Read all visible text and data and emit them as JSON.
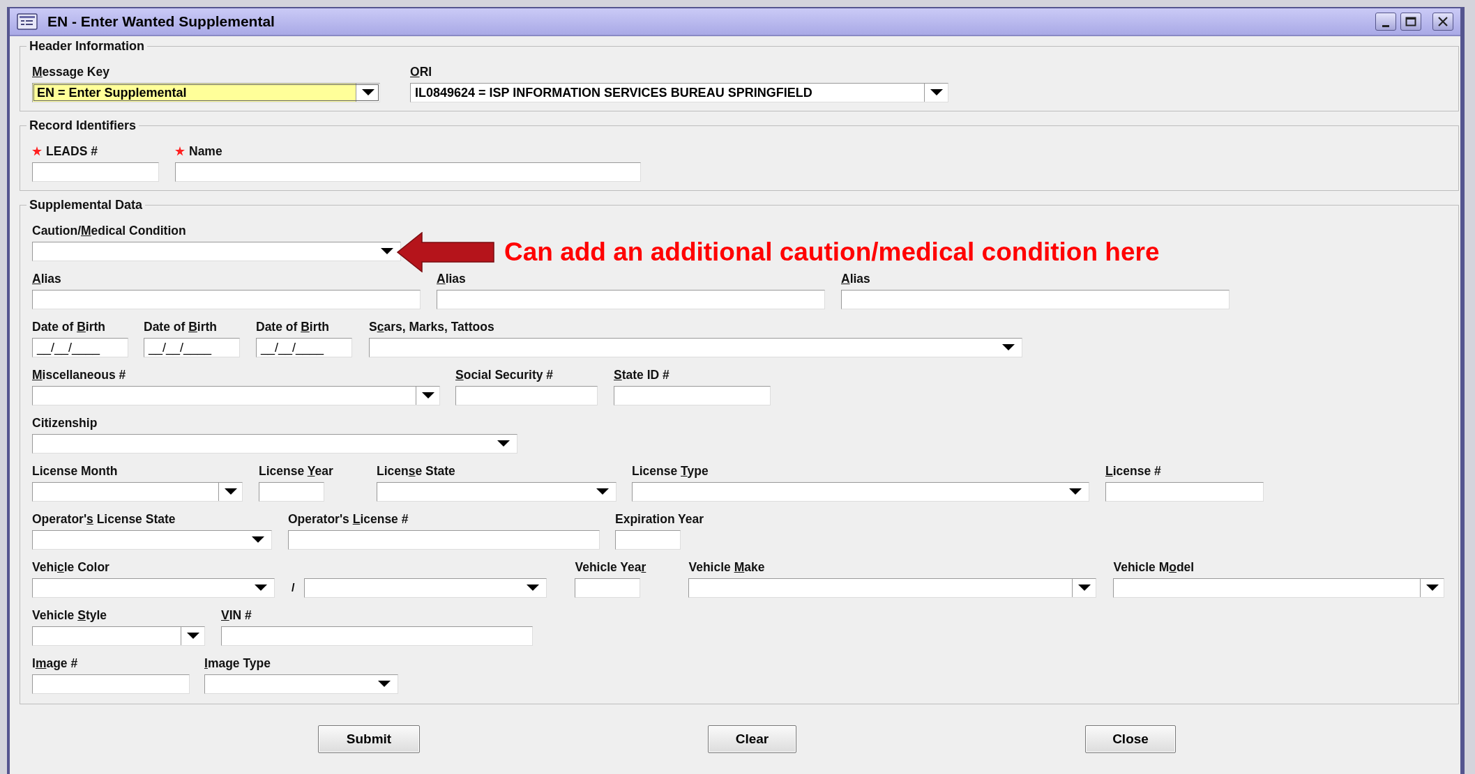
{
  "window": {
    "title": "EN - Enter Wanted Supplemental"
  },
  "header_information": {
    "title": "Header Information",
    "fields": [
      {
        "label": {
          "key": "M",
          "post": "essage Key"
        },
        "kind": "combo",
        "value": "EN = Enter Supplemental",
        "focused": true
      },
      {
        "label": {
          "key": "O",
          "post": "RI"
        },
        "kind": "combo",
        "value": "IL0849624 = ISP INFORMATION SERVICES BUREAU SPRINGFIELD",
        "focused": false
      }
    ]
  },
  "record_identifiers": {
    "title": "Record Identifiers",
    "fields": [
      {
        "label": "LEADS #",
        "kind": "text",
        "required": true
      },
      {
        "label": "Name",
        "kind": "text",
        "required": true
      }
    ]
  },
  "supplemental_data": {
    "title": "Supplemental Data",
    "annotation": "Can add an additional caution/medical condition here",
    "lines": [
      {
        "fields": [
          {
            "label": {
              "pre": "Caution/",
              "key": "M",
              "post": "edical Condition"
            },
            "kind": "select"
          }
        ]
      },
      {
        "fields": [
          {
            "label": {
              "key": "A",
              "post": "lias"
            },
            "kind": "text"
          },
          {
            "label": {
              "key": "A",
              "post": "lias"
            },
            "kind": "text"
          },
          {
            "label": {
              "key": "A",
              "post": "lias"
            },
            "kind": "text"
          }
        ]
      },
      {
        "fields": [
          {
            "label": {
              "pre": "Date of ",
              "key": "B",
              "post": "irth"
            },
            "kind": "date",
            "value": "__/__/____"
          },
          {
            "label": {
              "pre": "Date of ",
              "key": "B",
              "post": "irth"
            },
            "kind": "date",
            "value": "__/__/____"
          },
          {
            "label": {
              "pre": "Date of ",
              "key": "B",
              "post": "irth"
            },
            "kind": "date",
            "value": "__/__/____"
          },
          {
            "label": {
              "pre": "S",
              "key": "c",
              "post": "ars, Marks, Tattoos"
            },
            "kind": "select"
          }
        ]
      },
      {
        "fields": [
          {
            "label": {
              "key": "M",
              "post": "iscellaneous #"
            },
            "kind": "combo"
          },
          {
            "label": {
              "key": "S",
              "post": "ocial Security #"
            },
            "kind": "text"
          },
          {
            "label": {
              "key": "S",
              "post": "tate ID #"
            },
            "kind": "text"
          }
        ]
      },
      {
        "fields": [
          {
            "label": "Citizenship",
            "kind": "select"
          }
        ]
      },
      {
        "fields": [
          {
            "label": "License Month",
            "kind": "combo"
          },
          {
            "label": {
              "pre": "License ",
              "key": "Y",
              "post": "ear"
            },
            "kind": "text"
          },
          {
            "label": {
              "pre": "Licen",
              "key": "s",
              "post": "e State"
            },
            "kind": "select"
          },
          {
            "label": {
              "pre": "License ",
              "key": "T",
              "post": "ype"
            },
            "kind": "select"
          },
          {
            "label": {
              "key": "L",
              "post": "icense #"
            },
            "kind": "text"
          }
        ]
      },
      {
        "fields": [
          {
            "label": {
              "pre": "Operator'",
              "key": "s",
              "post": " License State"
            },
            "kind": "select"
          },
          {
            "label": {
              "pre": "Operator's ",
              "key": "L",
              "post": "icense #"
            },
            "kind": "text"
          },
          {
            "label": "Expiration Year",
            "kind": "text"
          }
        ]
      },
      {
        "fields": [
          {
            "label": {
              "pre": "Vehi",
              "key": "c",
              "post": "le Color"
            },
            "kind": "select"
          },
          {
            "kind": "separator",
            "text": "/"
          },
          {
            "kind": "select"
          },
          {
            "label": {
              "pre": "Vehicle Yea",
              "key": "r"
            },
            "kind": "text"
          },
          {
            "label": {
              "pre": "Vehicle ",
              "key": "M",
              "post": "ake"
            },
            "kind": "combo"
          },
          {
            "label": {
              "pre": "Vehicle M",
              "key": "o",
              "post": "del"
            },
            "kind": "combo"
          }
        ]
      },
      {
        "fields": [
          {
            "label": {
              "pre": "Vehicle ",
              "key": "S",
              "post": "tyle"
            },
            "kind": "combo"
          },
          {
            "label": {
              "key": "V",
              "post": "IN #"
            },
            "kind": "text"
          }
        ]
      },
      {
        "fields": [
          {
            "label": {
              "pre": "I",
              "key": "m",
              "post": "age #"
            },
            "kind": "text"
          },
          {
            "label": {
              "key": "I",
              "post": "mage Type"
            },
            "kind": "select"
          }
        ]
      }
    ]
  },
  "buttons": [
    "Submit",
    "Clear",
    "Close"
  ]
}
